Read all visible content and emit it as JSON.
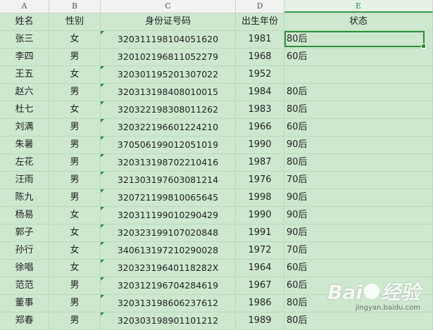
{
  "columns": [
    "A",
    "B",
    "C",
    "D",
    "E"
  ],
  "header": {
    "name": "姓名",
    "gender": "性别",
    "id": "身份证号码",
    "year": "出生年份",
    "state": "状态"
  },
  "rows": [
    {
      "name": "张三",
      "gender": "女",
      "id": "320311198104051620",
      "year": "1981",
      "state": "80后"
    },
    {
      "name": "李四",
      "gender": "男",
      "id": "320102196811052279",
      "year": "1968",
      "state": "60后"
    },
    {
      "name": "王五",
      "gender": "女",
      "id": "320301195201307022",
      "year": "1952",
      "state": ""
    },
    {
      "name": "赵六",
      "gender": "男",
      "id": "320313198408010015",
      "year": "1984",
      "state": "80后"
    },
    {
      "name": "杜七",
      "gender": "女",
      "id": "320322198308011262",
      "year": "1983",
      "state": "80后"
    },
    {
      "name": "刘满",
      "gender": "男",
      "id": "320322196601224210",
      "year": "1966",
      "state": "60后"
    },
    {
      "name": "朱暑",
      "gender": "男",
      "id": "370506199012051019",
      "year": "1990",
      "state": "90后"
    },
    {
      "name": "左花",
      "gender": "男",
      "id": "320313198702210416",
      "year": "1987",
      "state": "80后"
    },
    {
      "name": "汪雨",
      "gender": "男",
      "id": "321303197603081214",
      "year": "1976",
      "state": "70后"
    },
    {
      "name": "陈九",
      "gender": "男",
      "id": "320721199810065645",
      "year": "1998",
      "state": "90后"
    },
    {
      "name": "杨易",
      "gender": "女",
      "id": "320311199010290429",
      "year": "1990",
      "state": "90后"
    },
    {
      "name": "郭子",
      "gender": "女",
      "id": "320323199107020848",
      "year": "1991",
      "state": "90后"
    },
    {
      "name": "孙行",
      "gender": "女",
      "id": "340613197210290028",
      "year": "1972",
      "state": "70后"
    },
    {
      "name": "徐唱",
      "gender": "女",
      "id": "32032319640118282X",
      "year": "1964",
      "state": "60后"
    },
    {
      "name": "范范",
      "gender": "男",
      "id": "320312196704284619",
      "year": "1967",
      "state": "60后"
    },
    {
      "name": "董事",
      "gender": "男",
      "id": "320313198606237612",
      "year": "1986",
      "state": "80后"
    },
    {
      "name": "郑春",
      "gender": "男",
      "id": "320303198901101212",
      "year": "1989",
      "state": "80后"
    }
  ],
  "watermark": {
    "logo_left": "Bai",
    "logo_right": "经验",
    "url": "jingyan.baidu.com"
  },
  "colors": {
    "grid_bg": "#cde8cf",
    "selection": "#2f8f3a",
    "error_indicator": "#1e8e3e"
  }
}
